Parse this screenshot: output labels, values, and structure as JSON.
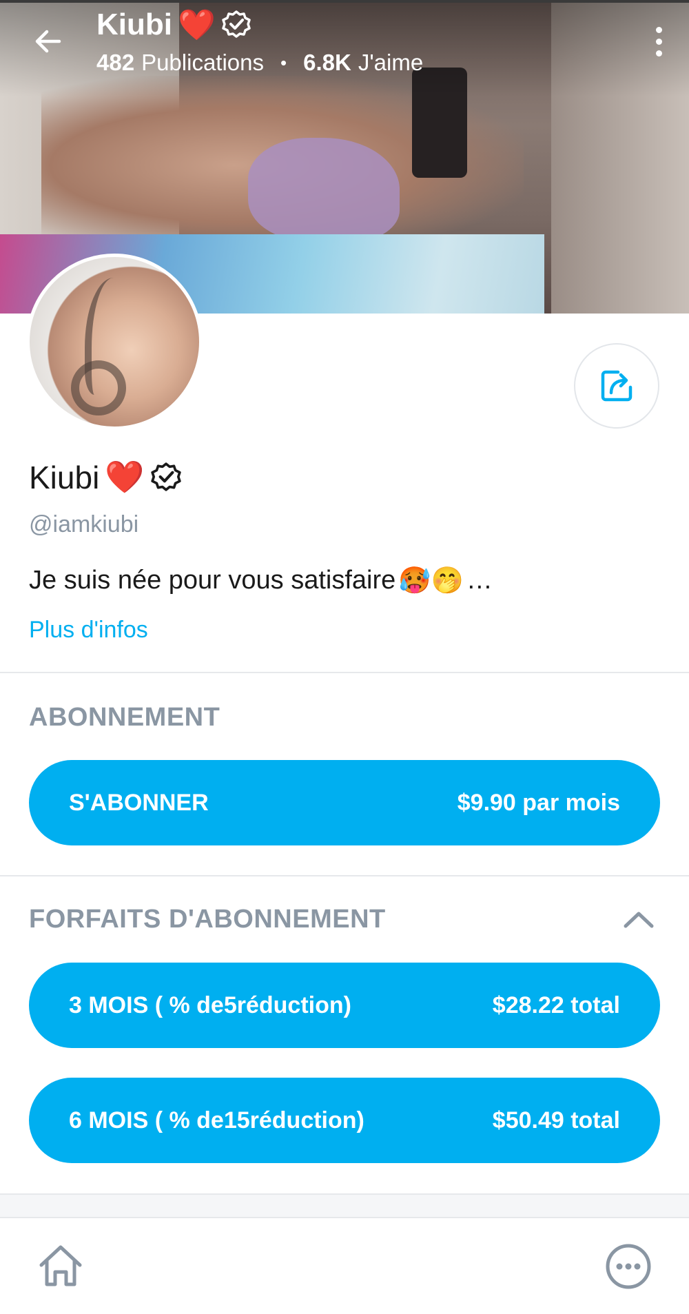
{
  "header": {
    "name": "Kiubi",
    "heart": "❤️",
    "posts_count": "482",
    "posts_label": "Publications",
    "separator": "•",
    "likes_count": "6.8K",
    "likes_label": "J'aime"
  },
  "profile": {
    "name": "Kiubi",
    "heart": "❤️",
    "username": "@iamkiubi",
    "bio": "Je suis née pour vous satisfaire",
    "bio_emojis": "🥵🤭",
    "bio_ellipsis": "…",
    "more_info": "Plus d'infos"
  },
  "subscription": {
    "section_title": "ABONNEMENT",
    "subscribe_label": "S'ABONNER",
    "subscribe_price": "$9.90 par mois"
  },
  "bundles": {
    "section_title": "FORFAITS D'ABONNEMENT",
    "items": [
      {
        "label": "3 MOIS ( % de5réduction)",
        "price": "$28.22 total"
      },
      {
        "label": "6 MOIS ( % de15réduction)",
        "price": "$50.49 total"
      }
    ]
  },
  "colors": {
    "accent": "#00aff0",
    "muted": "#8a96a3",
    "text": "#1a1a1a"
  },
  "icons": {
    "back": "arrow-left-icon",
    "more": "more-vertical-icon",
    "verified": "verified-badge-icon",
    "share": "share-icon",
    "chevron": "chevron-up-icon",
    "home": "home-icon",
    "more_nav": "more-horizontal-icon"
  }
}
